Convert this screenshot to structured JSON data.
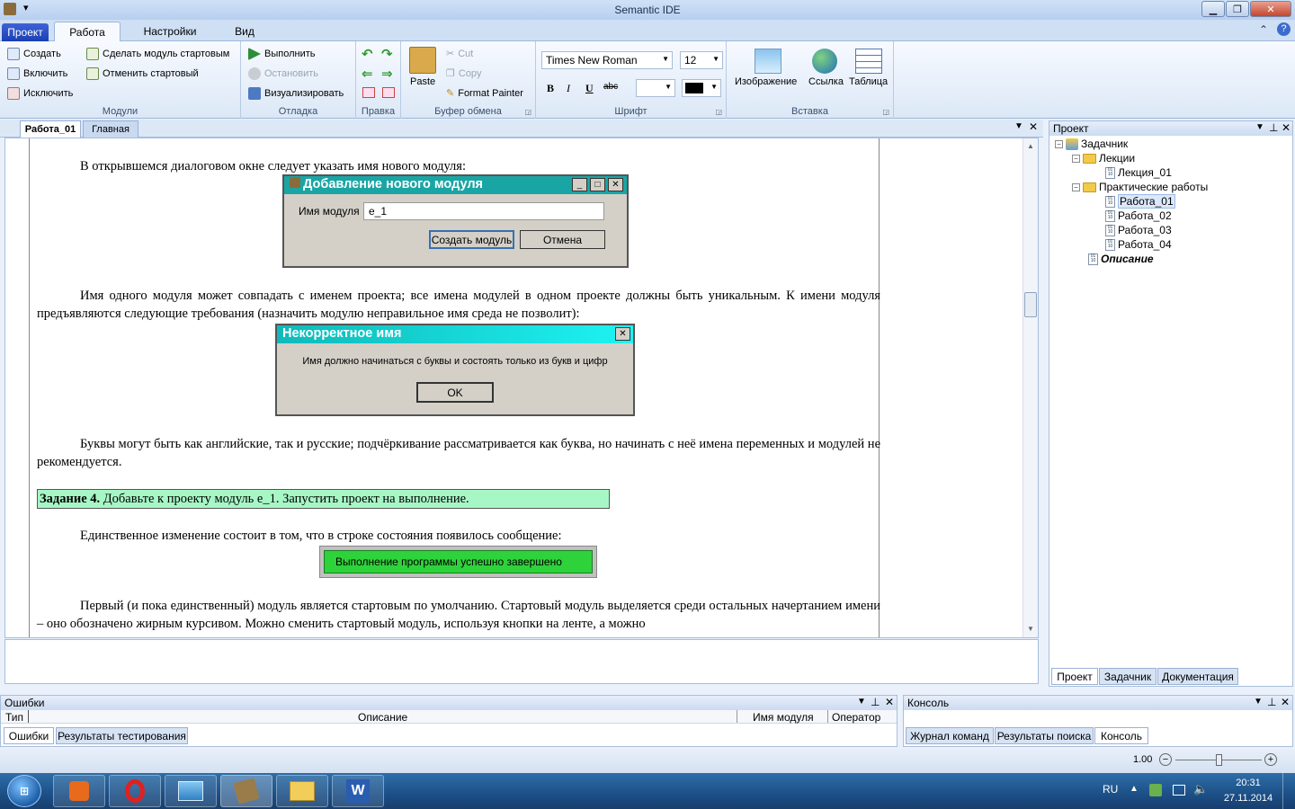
{
  "window": {
    "title": "Semantic IDE"
  },
  "ribbon_tabs": [
    "Проект",
    "Работа",
    "Настройки",
    "Вид"
  ],
  "groups": {
    "modules": {
      "label": "Модули",
      "create": "Создать",
      "include": "Включить",
      "exclude": "Исключить",
      "make_start": "Сделать модуль стартовым",
      "cancel_start": "Отменить стартовый"
    },
    "debug": {
      "label": "Отладка",
      "run": "Выполнить",
      "stop": "Остановить",
      "visualize": "Визуализировать"
    },
    "edit": {
      "label": "Правка"
    },
    "clipboard": {
      "label": "Буфер обмена",
      "paste": "Paste",
      "cut": "Cut",
      "copy": "Copy",
      "format_painter": "Format Painter"
    },
    "font": {
      "label": "Шрифт",
      "family": "Times New Roman",
      "size": "12",
      "bold": "B",
      "italic": "I",
      "underline": "U",
      "strike": "abc"
    },
    "insert": {
      "label": "Вставка",
      "image": "Изображение",
      "link": "Ссылка",
      "table": "Таблица"
    }
  },
  "doc_tabs": [
    "Работа_01",
    "Главная"
  ],
  "document": {
    "p1": "В открывшемся диалоговом окне следует указать имя нового модуля:",
    "dialog1": {
      "title": "Добавление нового модуля",
      "label": "Имя модуля",
      "value": "e_1",
      "ok": "Создать модуль",
      "cancel": "Отмена"
    },
    "p2": "Имя одного модуля может совпадать с именем проекта; все имена модулей в одном проекте должны быть уникальным. К имени модуля предъявляются следующие требования (назначить модулю неправильное имя среда не позволит):",
    "dialog2": {
      "title": "Некорректное имя",
      "message": "Имя должно начинаться с буквы и состоять только из букв и цифр",
      "ok": "OK"
    },
    "p3": "Буквы могут быть как английские, так и русские; подчёркивание рассматривается как буква, но начинать с неё имена переменных и модулей не рекомендуется.",
    "task_label": "Задание 4.",
    "task_text": " Добавьте к проекту модуль e_1. Запустить проект на выполнение.",
    "p4": "Единственное изменение состоит в том, что в строке состояния появилось сообщение:",
    "status_msg": "Выполнение программы успешно завершено",
    "p5": "Первый (и пока единственный) модуль является стартовым по умолчанию. Стартовый модуль выделяется среди остальных начертанием имени – оно обозначено жирным курсивом. Можно сменить стартовый модуль, используя кнопки на ленте, а можно"
  },
  "project_panel": {
    "title": "Проект",
    "root": "Задачник",
    "lectures": "Лекции",
    "lecture1": "Лекция_01",
    "practice": "Практические работы",
    "works": [
      "Работа_01",
      "Работа_02",
      "Работа_03",
      "Работа_04"
    ],
    "description": "Описание",
    "tabs": [
      "Проект",
      "Задачник",
      "Документация"
    ]
  },
  "errors_panel": {
    "title": "Ошибки",
    "columns": [
      "Тип",
      "Описание",
      "Имя модуля",
      "Оператор"
    ],
    "tabs": [
      "Ошибки",
      "Результаты тестирования"
    ]
  },
  "console_panel": {
    "title": "Консоль",
    "tabs": [
      "Журнал команд",
      "Результаты поиска",
      "Консоль"
    ]
  },
  "zoom": {
    "value": "1.00",
    "fraction": 0.5
  },
  "tray": {
    "lang": "RU",
    "time": "20:31",
    "date": "27.11.2014"
  },
  "colors": {
    "task_bg": "#a7f7c6",
    "status_green": "#2ed23a",
    "dialog1_caption": "#1aa5a5",
    "dialog2_caption": "#12c2c2"
  }
}
